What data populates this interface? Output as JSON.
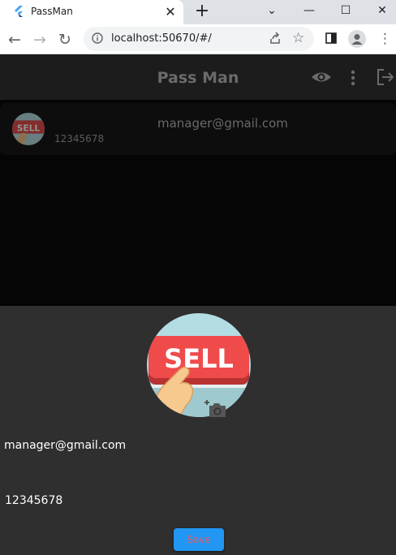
{
  "browser": {
    "tab_title": "PassMan",
    "tab_close": "✕",
    "new_tab": "+",
    "url": "localhost:50670/#/",
    "window_buttons": {
      "minimize": "—",
      "maximize": "☐",
      "close": "✕",
      "dropdown": "⌄"
    },
    "nav": {
      "back": "←",
      "forward": "→",
      "reload": "↻"
    },
    "menu": "⋮",
    "star": "☆"
  },
  "app": {
    "title": "Pass Man",
    "icons": [
      "eye-icon",
      "more-vert-icon",
      "logout-icon"
    ]
  },
  "entry": {
    "email": "manager@gmail.com",
    "password": "12345678",
    "image_label": "SELL"
  },
  "form": {
    "email": "manager@gmail.com",
    "password": "12345678",
    "save_label": "Save"
  },
  "colors": {
    "appbar": "#1c1c1c",
    "background": "#050505",
    "sheet": "#2f2f2f",
    "save_button": "#2196f3",
    "save_text": "#f05a5a",
    "sell_red": "#ef4b4b"
  }
}
